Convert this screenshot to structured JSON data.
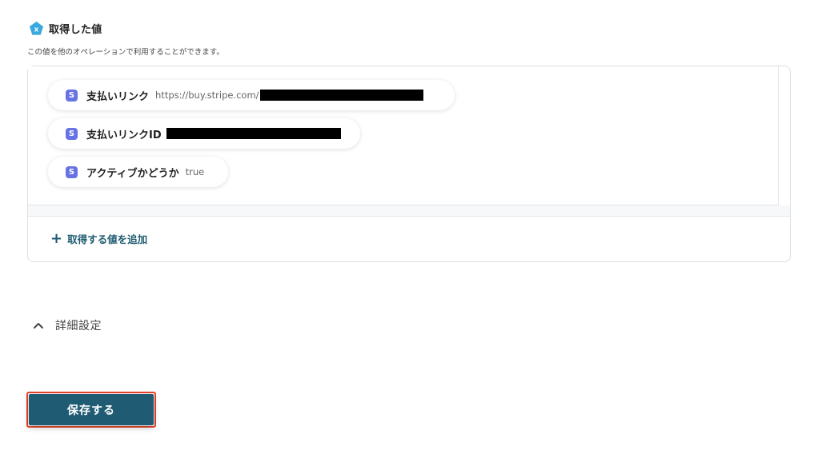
{
  "header": {
    "title": "取得した値",
    "icon": "pentagon-x-icon",
    "icon_color": "#3aa9df"
  },
  "subtitle": "この値を他のオペレーションで利用することができます。",
  "values": [
    {
      "badge": "S",
      "label": "支払いリンク",
      "value": "https://buy.stripe.com/",
      "redacted": true
    },
    {
      "badge": "S",
      "label": "支払いリンクID",
      "value": "",
      "redacted": true
    },
    {
      "badge": "S",
      "label": "アクティブかどうか",
      "value": "true",
      "redacted": false
    }
  ],
  "add_button": {
    "icon": "plus-icon",
    "label": "取得する値を追加"
  },
  "advanced": {
    "icon": "chevron-up-icon",
    "label": "詳細設定"
  },
  "save_button": {
    "label": "保存する"
  },
  "colors": {
    "accent": "#1f5b73",
    "stripe_badge": "#6772e5",
    "highlight_border": "#e8452a"
  }
}
